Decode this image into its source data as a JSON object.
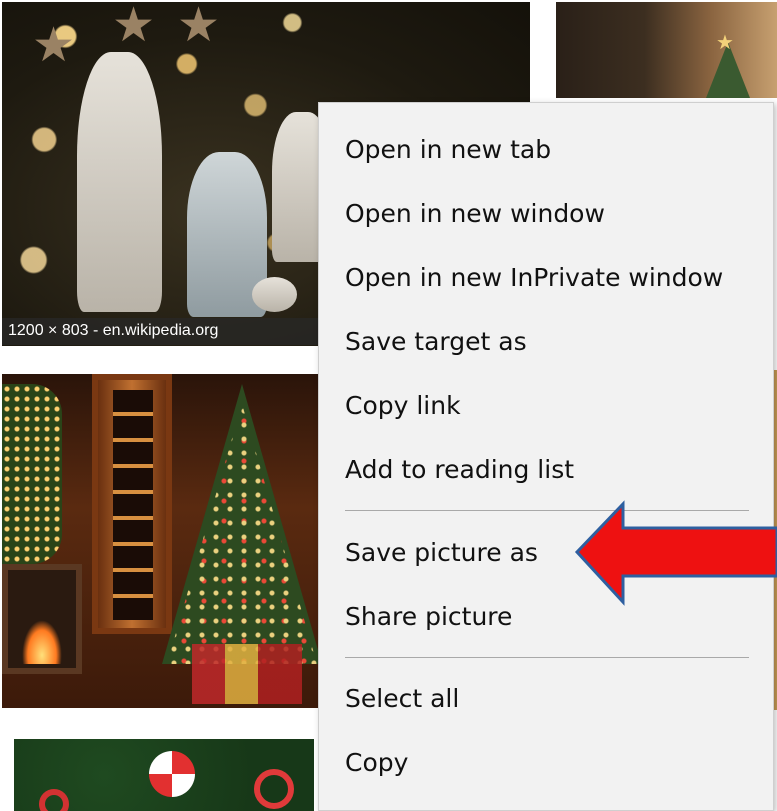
{
  "images": {
    "nativity": {
      "caption": "1200 × 803 - en.wikipedia.org"
    }
  },
  "context_menu": {
    "items": [
      {
        "label": "Open in new tab"
      },
      {
        "label": "Open in new window"
      },
      {
        "label": "Open in new InPrivate window"
      },
      {
        "label": "Save target as"
      },
      {
        "label": "Copy link"
      },
      {
        "label": "Add to reading list"
      },
      {
        "label": "Save picture as"
      },
      {
        "label": "Share picture"
      },
      {
        "label": "Select all"
      },
      {
        "label": "Copy"
      }
    ]
  },
  "annotation": {
    "arrow_color": "#ee1111",
    "arrow_outline": "#2e5fa0",
    "points_to": "Save picture as"
  },
  "colors": {
    "menu_background": "#f2f2f2",
    "menu_text": "#111111",
    "separator": "#a9a9a9"
  }
}
